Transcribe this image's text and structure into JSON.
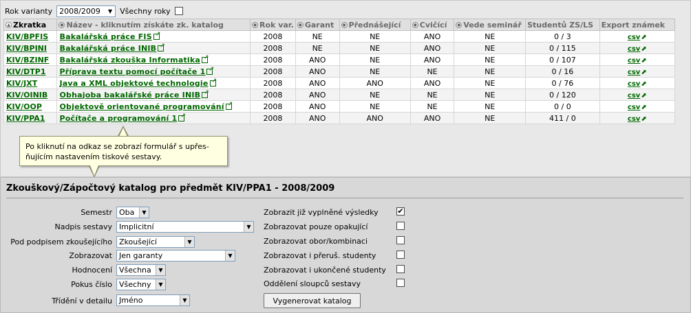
{
  "filter": {
    "year_label": "Rok varianty",
    "year_value": "2008/2009",
    "all_years_label": "Všechny roky"
  },
  "table": {
    "headers": [
      "Zkratka",
      "Název - kliknutím získáte zk. katalog",
      "Rok var.",
      "Garant",
      "Přednášející",
      "Cvičící",
      "Vede seminář",
      "Studentů ZS/LS",
      "Export známek"
    ],
    "rows": [
      {
        "code": "KIV/BPFIS",
        "name": "Bakalářská práce FIS",
        "year": "2008",
        "garant": "NE",
        "lecturer": "NE",
        "tutor": "ANO",
        "seminar": "NE",
        "students": "0 / 3",
        "export": "csv"
      },
      {
        "code": "KIV/BPINI",
        "name": "Bakalářská práce INIB",
        "year": "2008",
        "garant": "NE",
        "lecturer": "NE",
        "tutor": "ANO",
        "seminar": "NE",
        "students": "0 / 115",
        "export": "csv"
      },
      {
        "code": "KIV/BZINF",
        "name": "Bakalářská zkouška Informatika",
        "year": "2008",
        "garant": "ANO",
        "lecturer": "NE",
        "tutor": "ANO",
        "seminar": "NE",
        "students": "0 / 107",
        "export": "csv"
      },
      {
        "code": "KIV/DTP1",
        "name": "Příprava textu pomocí počítače 1",
        "year": "2008",
        "garant": "ANO",
        "lecturer": "NE",
        "tutor": "NE",
        "seminar": "NE",
        "students": "0 / 16",
        "export": "csv"
      },
      {
        "code": "KIV/JXT",
        "name": "Java a XML objektové technologie",
        "year": "2008",
        "garant": "ANO",
        "lecturer": "ANO",
        "tutor": "ANO",
        "seminar": "NE",
        "students": "0 / 76",
        "export": "csv"
      },
      {
        "code": "KIV/OINIB",
        "name": "Obhajoba bakalářské práce INIB",
        "year": "2008",
        "garant": "ANO",
        "lecturer": "NE",
        "tutor": "NE",
        "seminar": "NE",
        "students": "0 / 120",
        "export": "csv"
      },
      {
        "code": "KIV/OOP",
        "name": "Objektově orientované programování",
        "year": "2008",
        "garant": "ANO",
        "lecturer": "NE",
        "tutor": "NE",
        "seminar": "NE",
        "students": "0 / 0",
        "export": "csv"
      },
      {
        "code": "KIV/PPA1",
        "name": "Počítače a programování 1",
        "year": "2008",
        "garant": "ANO",
        "lecturer": "ANO",
        "tutor": "ANO",
        "seminar": "NE",
        "students": "411 / 0",
        "export": "csv"
      }
    ]
  },
  "tooltip": {
    "text_line1": "Po kliknutí na odkaz se zobrazí formulář s upřes-",
    "text_line2": "ňujícím nastavením tiskové sestavy."
  },
  "form": {
    "title": "Zkouškový/Zápočtový katalog pro předmět  KIV/PPA1 - 2008/2009",
    "semestr_label": "Semestr",
    "semestr_value": "Oba",
    "nadpis_label": "Nadpis sestavy",
    "nadpis_value": "Implicitní",
    "podpis_label": "Pod podpisem zkoušejícího",
    "podpis_value": "Zkoušející",
    "zobrazovat_label": "Zobrazovat",
    "zobrazovat_value": "Jen garanty",
    "hodnoceni_label": "Hodnocení",
    "hodnoceni_value": "Všechna",
    "pokus_label": "Pokus číslo",
    "pokus_value": "Všechny",
    "trideni_label": "Třídění v detailu",
    "trideni_value": "Jméno",
    "options": [
      {
        "label": "Zobrazit již vyplněné výsledky",
        "checked": "✔"
      },
      {
        "label": "Zobrazovat pouze opakující",
        "checked": ""
      },
      {
        "label": "Zobrazovat obor/kombinaci",
        "checked": ""
      },
      {
        "label": "Zobrazovat i přeruš. studenty",
        "checked": ""
      },
      {
        "label": "Zobrazovat i ukončené studenty",
        "checked": ""
      },
      {
        "label": "Oddělení sloupců sestavy",
        "checked": ""
      }
    ],
    "generate_label": "Vygenerovat katalog"
  }
}
